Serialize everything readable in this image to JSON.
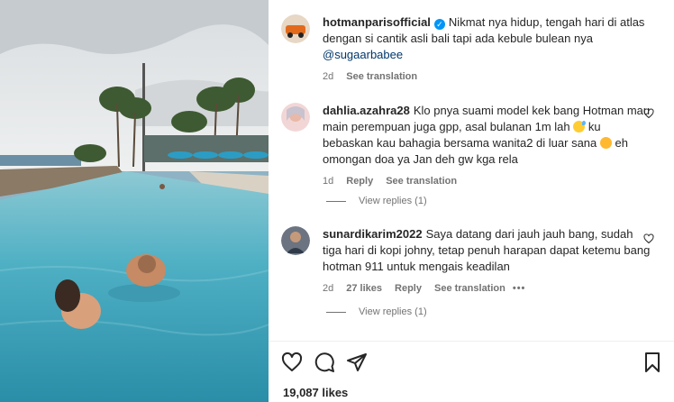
{
  "caption": {
    "username": "hotmanparisofficial",
    "text": "Nikmat nya hidup, tengah hari di atlas dengan si cantik asli bali tapi ada kebule bulean nya",
    "mention": "@sugaarbabee",
    "age": "2d",
    "see_translation": "See translation"
  },
  "comments": [
    {
      "username": "dahlia.azahra28",
      "text_1": "Klo pnya suami model kek bang Hotman mau main perempuan juga gpp, asal bulanan 1m lah",
      "text_2": "ku bebaskan kau bahagia bersama wanita2 di luar sana",
      "text_3": "eh omongan doa ya Jan deh gw kga rela",
      "age": "1d",
      "reply": "Reply",
      "see_translation": "See translation",
      "view_replies": "View replies (1)"
    },
    {
      "username": "sunardikarim2022",
      "text": "Saya datang dari jauh jauh bang, sudah tiga hari di kopi johny, tetap penuh harapan dapat ketemu bang hotman 911 untuk mengais keadilan",
      "age": "2d",
      "likes": "27 likes",
      "reply": "Reply",
      "see_translation": "See translation",
      "more": "•••",
      "view_replies": "View replies (1)"
    }
  ],
  "icons": {
    "like": "heart-icon",
    "comment": "comment-icon",
    "share": "send-icon",
    "save": "bookmark-icon",
    "verified": "verified-badge-icon",
    "comment_like": "small-heart-icon"
  },
  "verified_glyph": "✓",
  "likes_count": "19,087 likes",
  "colors": {
    "verified": "#0095f6",
    "secondary_text": "#737373",
    "mention": "#00376b"
  }
}
